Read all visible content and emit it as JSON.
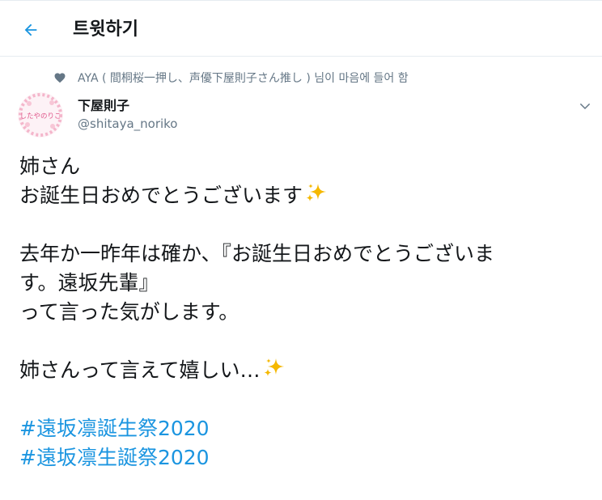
{
  "header": {
    "title": "트윗하기"
  },
  "context": {
    "text": "AYA ( 間桐桜一押し、声優下屋則子さん推し )  님이 마음에 들어 함"
  },
  "author": {
    "display_name": "下屋則子",
    "handle": "@shitaya_noriko",
    "avatar_text": "したやのりこ"
  },
  "tweet": {
    "line1": "姉さん",
    "line2": "お誕生日おめでとうございます",
    "line3": "去年か一昨年は確か、『お誕生日おめでとうございま",
    "line4": "す。遠坂先輩』",
    "line5": "って言った気がします。",
    "line6": "姉さんって言えて嬉しい…",
    "hashtag1": "#遠坂凛誕生祭2020",
    "hashtag2": "#遠坂凛生誕祭2020"
  },
  "colors": {
    "accent": "#1b95e0",
    "secondary_text": "#657786",
    "sparkle": "#f5b800"
  }
}
